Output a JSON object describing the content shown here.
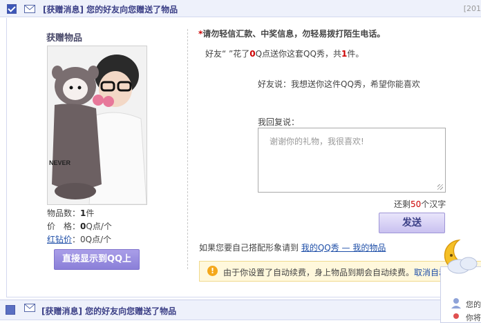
{
  "top_message": {
    "tag": "[获赠消息]",
    "title": "您的好友向您赠送了物品",
    "date": "[201"
  },
  "gift": {
    "section_title": "获赠物品",
    "photo_text": "NEVER",
    "count_label": "物品数：",
    "count_value": "1",
    "count_unit": "件",
    "price_label": "价　格：",
    "price_value": "0",
    "price_unit": "Q点/个",
    "diamond_label": "红钻价",
    "diamond_value": "：0Q点/个",
    "display_button": "直接显示到QQ上"
  },
  "right": {
    "warning_star": "*",
    "warning": "请勿轻信汇款、中奖信息，勿轻易拨打陌生电话。",
    "line1_prefix": "好友“ ”花了",
    "line1_amount": "0",
    "line1_mid": "Q点送你这套QQ秀，共",
    "line1_count": "1",
    "line1_suffix": "件。",
    "friend_said": "好友说：我想送你这件QQ秀，希望你能喜欢",
    "reply_label": "我回复说：",
    "reply_placeholder": "谢谢你的礼物，我很喜欢!",
    "remain_prefix": "还剩",
    "remain_count": "50",
    "remain_suffix": "个汉字",
    "send_button": "发送",
    "link_prefix": "如果您要自己搭配形象请到 ",
    "link_qqshow": "我的QQ秀 — 我的物品",
    "notice_icon": "!",
    "notice_text": "由于你设置了自动续费，身上物品到期会自动续费。",
    "notice_link": "取消自动"
  },
  "bottom_message": {
    "tag": "[获赠消息]",
    "title": "您的好友向您赠送了物品"
  },
  "popup": {
    "line1": "您的",
    "line2": "你将"
  }
}
